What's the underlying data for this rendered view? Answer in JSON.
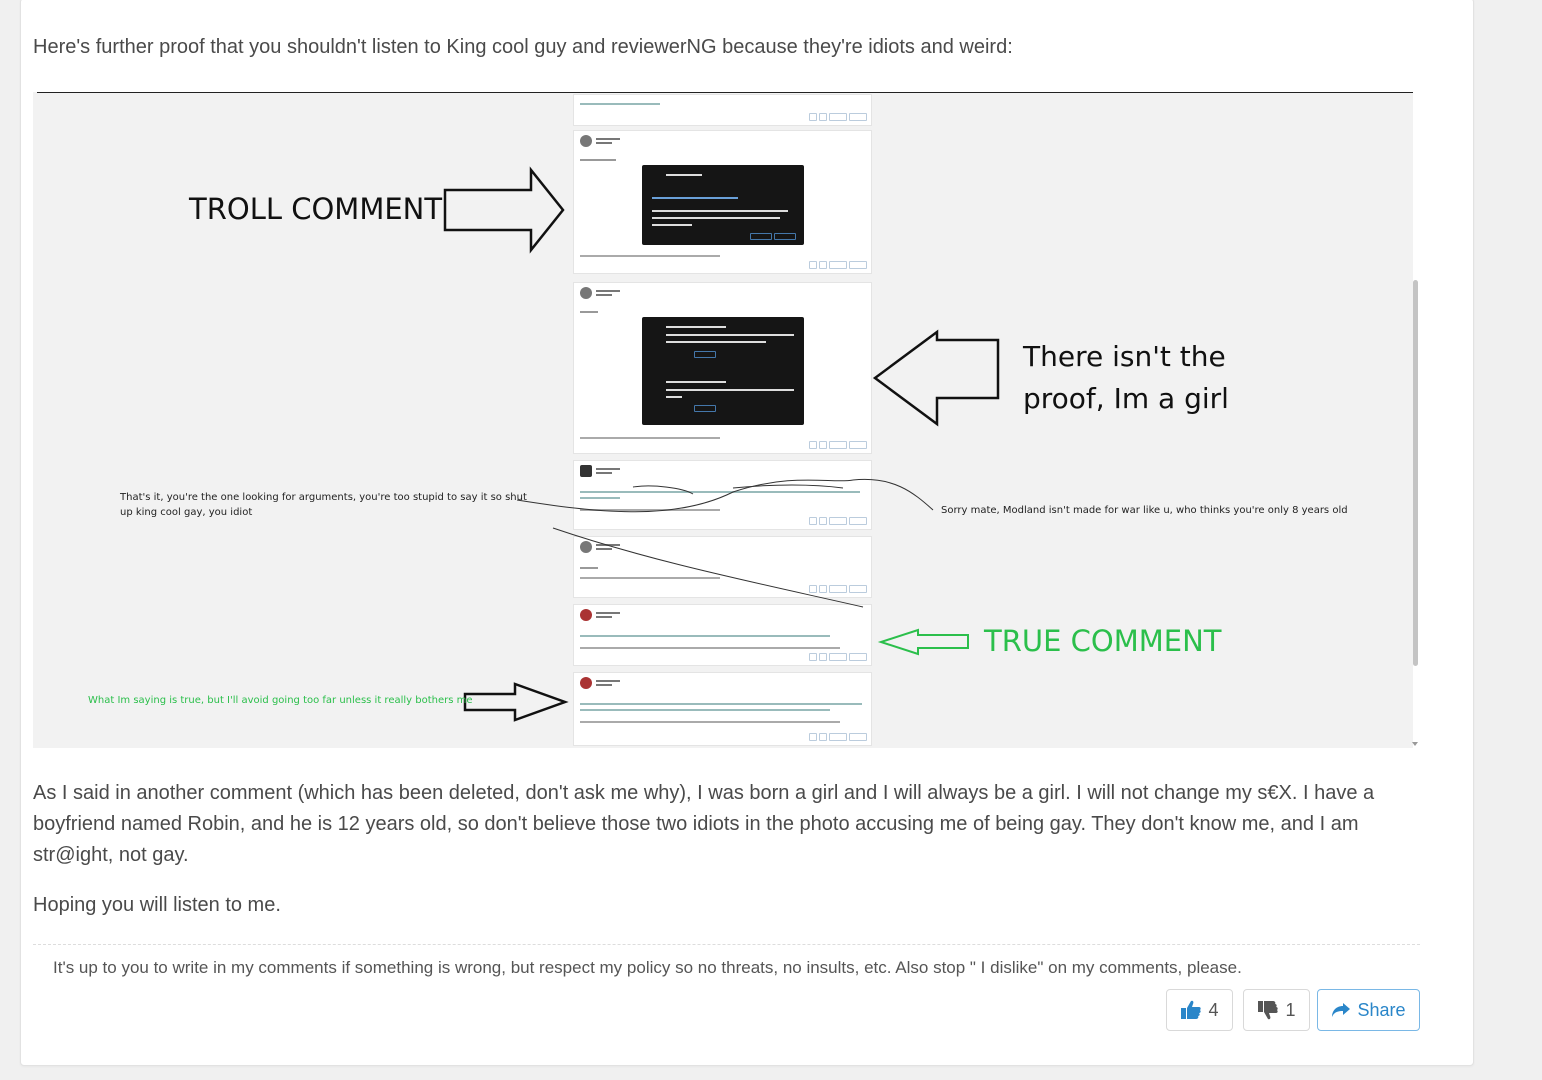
{
  "post": {
    "intro": "Here's further proof that you shouldn't listen to King cool guy and reviewerNG because they're idiots and weird:",
    "body": "As I said in another comment (which has been deleted, don't ask me why), I was born a girl and I will always be a girl. I will not change my s€X. I have a boyfriend named Robin, and he is 12 years old, so don't believe those two idiots in the photo accusing me of being gay. They don't know me, and I am str@ight, not gay.",
    "closing": "Hoping you will listen to me.",
    "policy": "It's up to you to write in my comments if something is wrong, but respect my policy so no threats, no insults, etc. Also stop \" I dislike\" on my comments, please."
  },
  "image_annotations": {
    "troll": "TROLL COMMENT",
    "proof_line1": "There isn't the",
    "proof_line2": "proof, Im a girl",
    "left_note_line1": "That's it, you're the one looking for arguments, you're too stupid to say it so shut",
    "left_note_line2": "up king cool gay, you idiot",
    "right_note": "Sorry mate, Modland isn't made for war like u, who thinks you're only 8 years old",
    "true_comment": "TRUE COMMENT",
    "green_note": "What Im saying is true,  but I'll avoid going too far unless it really bothers me"
  },
  "actions": {
    "likes": "4",
    "dislikes": "1",
    "share_label": "Share",
    "like_icon": "thumbs-up-icon",
    "dislike_icon": "thumbs-down-icon",
    "share_icon": "share-arrow-icon"
  },
  "colors": {
    "accent": "#2a86c9",
    "green_annotation": "#2bbf4b"
  }
}
